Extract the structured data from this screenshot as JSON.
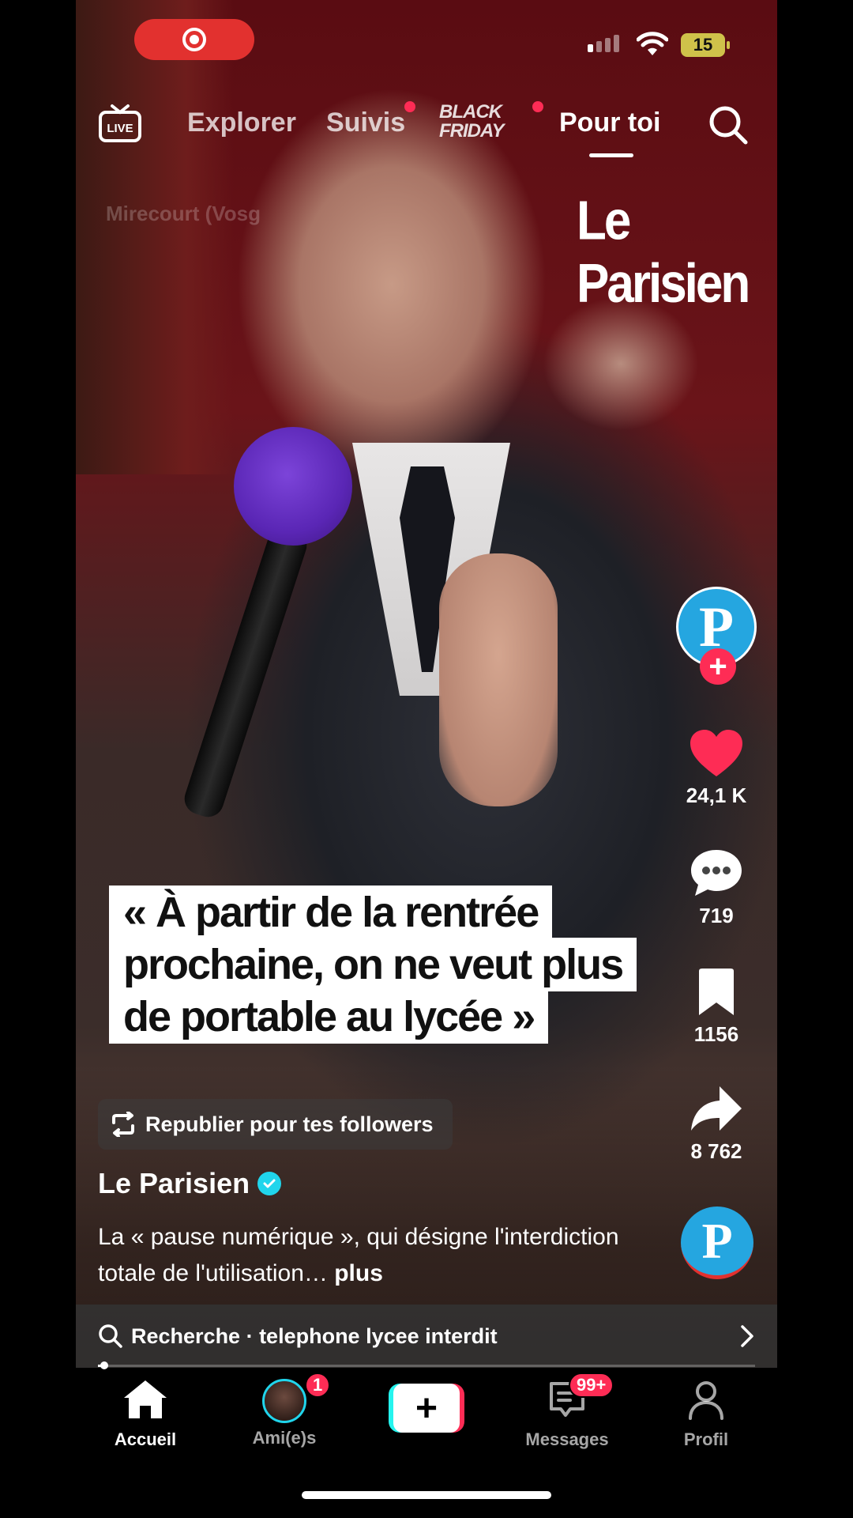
{
  "status_bar": {
    "battery": "15"
  },
  "top_nav": {
    "live_label": "LIVE",
    "tabs": [
      {
        "label": "Explorer"
      },
      {
        "label": "Suivis"
      },
      {
        "label": "Pour toi"
      }
    ],
    "black_friday": {
      "line1": "BLACK",
      "line2": "FRIDAY"
    }
  },
  "video": {
    "location": "Mirecourt (Vosg",
    "watermark": "Le Parisien",
    "caption_lines": [
      "« À partir de la rentrée",
      "prochaine, on ne veut plus",
      "de portable au lycée »"
    ]
  },
  "actions": {
    "avatar_letter": "P",
    "likes": "24,1 K",
    "comments": "719",
    "saves": "1156",
    "shares": "8 762",
    "colors": {
      "like": "#fe2c55",
      "follow": "#fe2c55",
      "brand": "#25a6e0"
    }
  },
  "post": {
    "repost_label": "Republier pour tes followers",
    "author": "Le Parisien",
    "description": "La « pause numérique », qui désigne l'interdiction totale de l'utilisation…",
    "more_label": "plus",
    "search_prefix": "Recherche · telephone lycee interdit",
    "progress": 0.01
  },
  "tab_bar": {
    "tabs": [
      {
        "label": "Accueil"
      },
      {
        "label": "Ami(e)s",
        "badge": "1"
      },
      {
        "label": "Messages",
        "badge": "99+"
      },
      {
        "label": "Profil"
      }
    ]
  }
}
